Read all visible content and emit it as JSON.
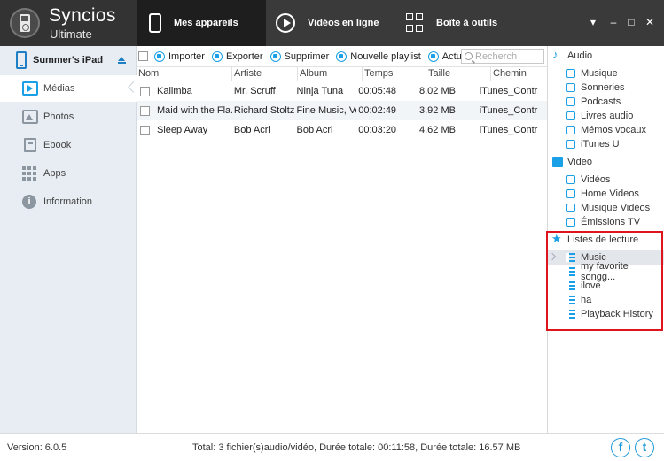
{
  "app": {
    "name": "Syncios",
    "edition": "Ultimate"
  },
  "tabs": [
    {
      "label": "Mes appareils",
      "icon": "phone-icon",
      "active": true
    },
    {
      "label": "Vidéos en ligne",
      "icon": "play-icon",
      "active": false
    },
    {
      "label": "Boîte à outils",
      "icon": "grid-icon",
      "active": false
    }
  ],
  "window_controls": {
    "menu": "▾",
    "minimize": "–",
    "maximize": "□",
    "close": "✕"
  },
  "device": {
    "name": "Summer's iPad"
  },
  "sidebar": {
    "items": [
      {
        "label": "Médias",
        "icon": "media-icon",
        "active": true
      },
      {
        "label": "Photos",
        "icon": "photos-icon",
        "active": false
      },
      {
        "label": "Ebook",
        "icon": "ebook-icon",
        "active": false
      },
      {
        "label": "Apps",
        "icon": "apps-icon",
        "active": false
      },
      {
        "label": "Information",
        "icon": "info-icon",
        "active": false
      }
    ]
  },
  "toolbar": {
    "import": "Importer",
    "export": "Exporter",
    "delete": "Supprimer",
    "new_playlist": "Nouvelle playlist",
    "refresh": "Actualis",
    "search_placeholder": "Recherch"
  },
  "table": {
    "columns": [
      "Nom",
      "Artiste",
      "Album",
      "Temps",
      "Taille",
      "Chemin"
    ],
    "rows": [
      {
        "name": "Kalimba",
        "artist": "Mr. Scruff",
        "album": "Ninja Tuna",
        "time": "00:05:48",
        "size": "8.02 MB",
        "path": "iTunes_Contr"
      },
      {
        "name": "Maid with the Fla...",
        "artist": "Richard Stoltz...",
        "album": "Fine Music, Vo...",
        "time": "00:02:49",
        "size": "3.92 MB",
        "path": "iTunes_Contr"
      },
      {
        "name": "Sleep Away",
        "artist": "Bob Acri",
        "album": "Bob Acri",
        "time": "00:03:20",
        "size": "4.62 MB",
        "path": "iTunes_Contr"
      }
    ]
  },
  "library": {
    "audio": {
      "title": "Audio",
      "items": [
        "Musique",
        "Sonneries",
        "Podcasts",
        "Livres audio",
        "Mémos vocaux",
        "iTunes U"
      ]
    },
    "video": {
      "title": "Video",
      "items": [
        "Vidéos",
        "Home Videos",
        "Musique Vidéos",
        "Émissions TV"
      ]
    },
    "playlists": {
      "title": "Listes de lecture",
      "items": [
        "Music",
        "my favorite songg...",
        "ilove",
        "ha",
        "Playback History"
      ],
      "selected": "Music"
    }
  },
  "status": {
    "version": "Version: 6.0.5",
    "totals": "Total: 3 fichier(s)audio/vidéo, Durée totale: 00:11:58, Durée totale: 16.57 MB"
  },
  "social": {
    "facebook": "f",
    "twitter": "t"
  },
  "colors": {
    "accent": "#1aa0e6",
    "topbar": "#3a3a3a",
    "highlight": "#e0141c"
  }
}
